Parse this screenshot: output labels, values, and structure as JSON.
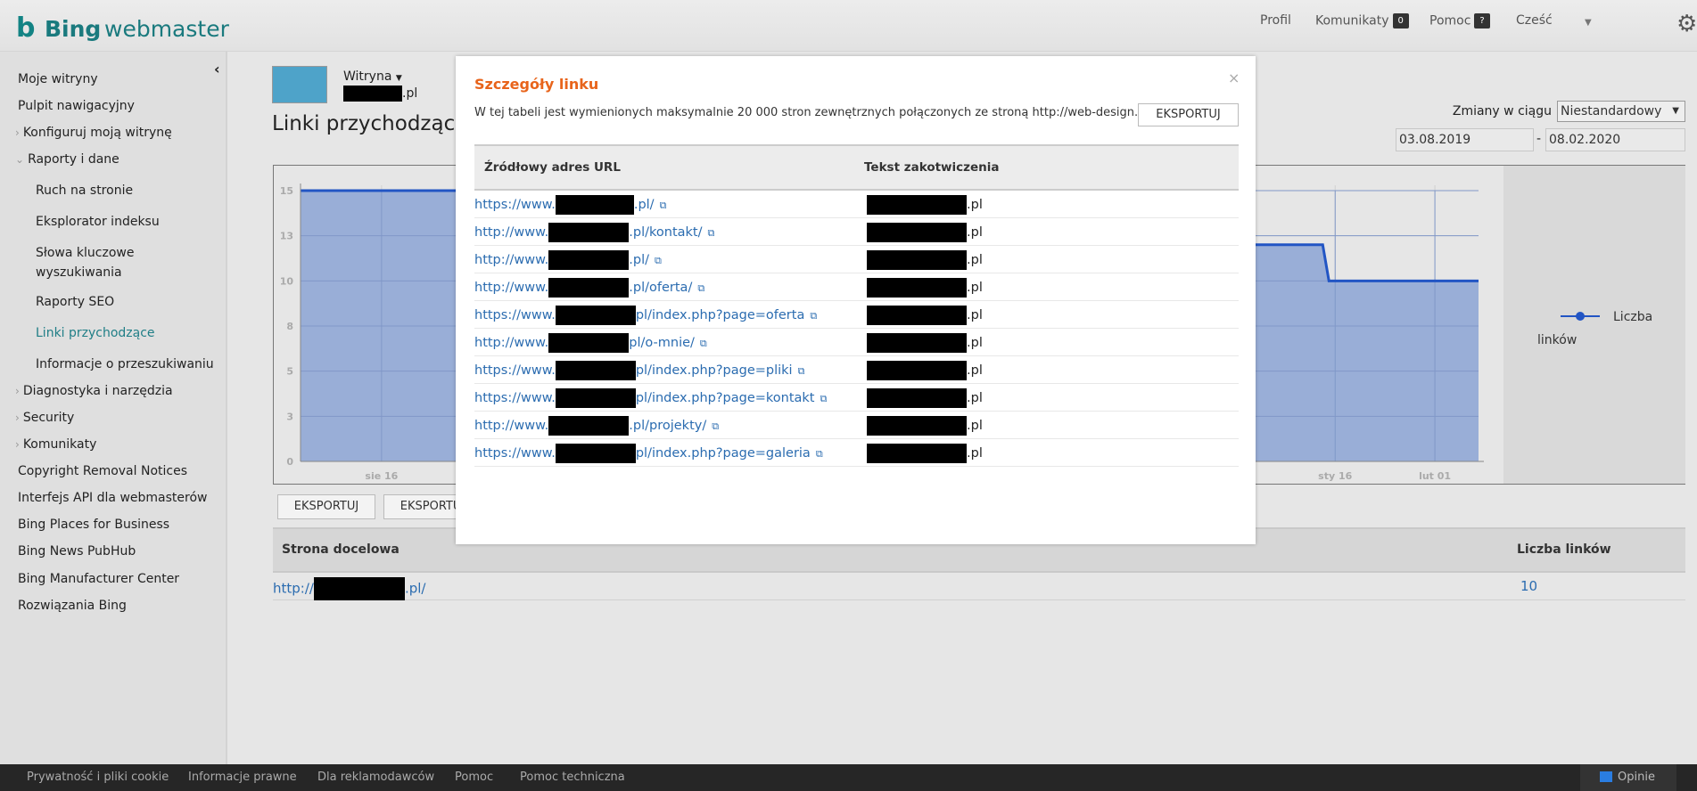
{
  "header": {
    "logo_b": "b",
    "logo_bing": "Bing",
    "logo_webmaster": "webmaster",
    "nav": {
      "profile": "Profil",
      "messages": "Komunikaty",
      "messages_count": "0",
      "help": "Pomoc",
      "help_badge": "?",
      "greeting": "Cześć"
    }
  },
  "sidebar": {
    "items": [
      {
        "label": "Moje witryny"
      },
      {
        "label": "Pulpit nawigacyjny"
      },
      {
        "label": "Konfiguruj moją witrynę",
        "chevron": "right"
      },
      {
        "label": "Raporty i dane",
        "chevron": "down"
      },
      {
        "label": "Ruch na stronie"
      },
      {
        "label": "Eksplorator indeksu"
      },
      {
        "label": "Słowa kluczowe wyszukiwania"
      },
      {
        "label": "Raporty SEO"
      },
      {
        "label": "Linki przychodzące",
        "active": true
      },
      {
        "label": "Informacje o przeszukiwaniu"
      },
      {
        "label": "Diagnostyka i narzędzia",
        "chevron": "right"
      },
      {
        "label": "Security",
        "chevron": "right"
      },
      {
        "label": "Komunikaty",
        "chevron": "right"
      },
      {
        "label": "Copyright Removal Notices"
      },
      {
        "label": "Interfejs API dla webmasterów"
      },
      {
        "label": "Bing Places for Business"
      },
      {
        "label": "Bing News PubHub"
      },
      {
        "label": "Bing Manufacturer Center"
      },
      {
        "label": "Rozwiązania Bing"
      }
    ]
  },
  "site": {
    "label": "Witryna",
    "domain_suffix": ".pl"
  },
  "page_title": "Linki przychodzące",
  "filters": {
    "period_label": "Zmiany w ciągu",
    "period_value": "Niestandardowy",
    "date_from": "03.08.2019",
    "date_sep": "-",
    "date_to": "08.02.2020"
  },
  "chart_data": {
    "type": "area",
    "x_ticks": [
      "sie 16",
      "sty 16",
      "lut 01"
    ],
    "y_ticks": [
      "0",
      "3",
      "5",
      "8",
      "10",
      "13",
      "15"
    ],
    "ylim": [
      0,
      15
    ],
    "xlim": [
      "2019-08-03",
      "2020-02-08"
    ],
    "legend": "Liczba linków",
    "legend_position": "right",
    "grid": true,
    "color": "#2255c4",
    "fill": "#95abd6",
    "series": [
      {
        "name": "Liczba linków",
        "points": [
          [
            "2019-08-03",
            15
          ],
          [
            "2019-08-28",
            15
          ],
          [
            "2020-01-02",
            12
          ],
          [
            "2020-01-14",
            12
          ],
          [
            "2020-01-15",
            10
          ],
          [
            "2020-02-08",
            10
          ]
        ]
      }
    ]
  },
  "export_buttons": [
    "EKSPORTUJ",
    "EKSPORTUJ"
  ],
  "table": {
    "headers": [
      "Strona docelowa",
      "Liczba linków"
    ],
    "rows": [
      {
        "prefix": "http://",
        "suffix": ".pl/",
        "count": "10"
      }
    ]
  },
  "footer": {
    "links": [
      "Prywatność i pliki cookie",
      "Informacje prawne",
      "Dla reklamodawców",
      "Pomoc",
      "Pomoc techniczna"
    ],
    "feedback": "Opinie"
  },
  "modal": {
    "title": "Szczegóły linku",
    "close": "×",
    "description": "W tej tabeli jest wymienionych maksymalnie 20 000 stron zewnętrznych połączonych ze stroną http://web-design.co.pl/.",
    "export": "EKSPORTUJ",
    "headers": [
      "Źródłowy adres URL",
      "Tekst zakotwiczenia"
    ],
    "rows": [
      {
        "prefix": "https://www.",
        "suffix": ".pl/",
        "anchor": ".pl"
      },
      {
        "prefix": "http://www.",
        "suffix": ".pl/kontakt/",
        "anchor": ".pl"
      },
      {
        "prefix": "http://www.",
        "suffix": ".pl/",
        "anchor": ".pl"
      },
      {
        "prefix": "http://www.",
        "suffix": ".pl/oferta/",
        "anchor": ".pl"
      },
      {
        "prefix": "https://www.",
        "suffix": "pl/index.php?page=oferta",
        "anchor": ".pl"
      },
      {
        "prefix": "http://www.",
        "suffix": "pl/o-mnie/",
        "anchor": ".pl"
      },
      {
        "prefix": "https://www.",
        "suffix": "pl/index.php?page=pliki",
        "anchor": ".pl"
      },
      {
        "prefix": "https://www.",
        "suffix": "pl/index.php?page=kontakt",
        "anchor": ".pl"
      },
      {
        "prefix": "http://www.",
        "suffix": ".pl/projekty/",
        "anchor": ".pl"
      },
      {
        "prefix": "https://www.",
        "suffix": "pl/index.php?page=galeria",
        "anchor": ".pl"
      }
    ]
  }
}
